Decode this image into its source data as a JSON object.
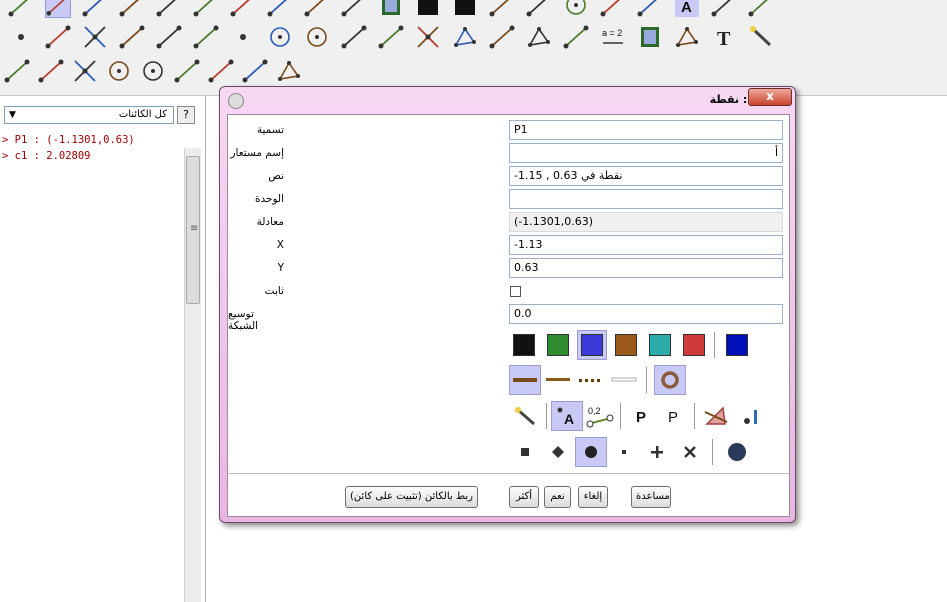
{
  "toolbar": {
    "rows": [
      [
        "point-arrow",
        "move-graphics",
        "rotate",
        "transform",
        "move-view",
        "insert-text",
        "image",
        "slider",
        "function-inspector",
        "reflect",
        "film",
        "black-square",
        "black-square-2",
        "pen",
        "line-tool",
        "circle-tool",
        "arrow",
        "cursor",
        "text-A",
        "point-label",
        "more"
      ],
      [
        "new-point",
        "line-two-points",
        "intersect",
        "segment",
        "ray",
        "vector",
        "midpoint",
        "circle-center",
        "circle-three-points",
        "compass",
        "parallel",
        "perpendicular",
        "polygon",
        "angle",
        "conic",
        "locus",
        "relation",
        "slide",
        "polygon-regular",
        "text",
        "magic-wand"
      ],
      [
        "tangents",
        "polar",
        "angle-bisector",
        "circle-arc",
        "circle-center-point",
        "locus-2",
        "dilate",
        "translate",
        "triangle"
      ]
    ],
    "selected": "move-graphics"
  },
  "algebra": {
    "filter_label": "كل الكائنات",
    "help_label": "?",
    "lines": [
      "> P1 : (-1.1301,0.63)",
      "> c1 : 2.02809"
    ]
  },
  "dialog": {
    "title": "تحرير : نقطة",
    "close_label": "x",
    "fields": [
      {
        "label": "تسمية",
        "value": "P1"
      },
      {
        "label": "إسم مستعار",
        "value": "أ"
      },
      {
        "label": "نص",
        "value": "نقطة في 0.63 , 1.15-"
      },
      {
        "label": "الوحدة",
        "value": ""
      },
      {
        "label": "معادلة",
        "value": "(-1.1301,0.63)",
        "readonly": true
      },
      {
        "label": "X",
        "value": "-1.13"
      },
      {
        "label": "Y",
        "value": "0.63"
      }
    ],
    "fixed_label": "ثابت",
    "fixed_checked": false,
    "grid_label": "توسيع الشبكة",
    "grid_value": "0.0",
    "colors": [
      "#111111",
      "#2e8b2e",
      "#3a3ad9",
      "#9a5a1a",
      "#2aaaa8",
      "#d03a3a"
    ],
    "selected_color_index": 2,
    "extra_color": "#0010b8",
    "line_styles": [
      "solid-thick",
      "solid-brown",
      "dotted",
      "thin-white"
    ],
    "buttons": {
      "attach": "(ربط بالكائن",
      "pin": "(تثبيت على كائن",
      "more": "أكثر",
      "ok": "نعم",
      "cancel": "إلغاء",
      "help": "مساعدة"
    }
  }
}
